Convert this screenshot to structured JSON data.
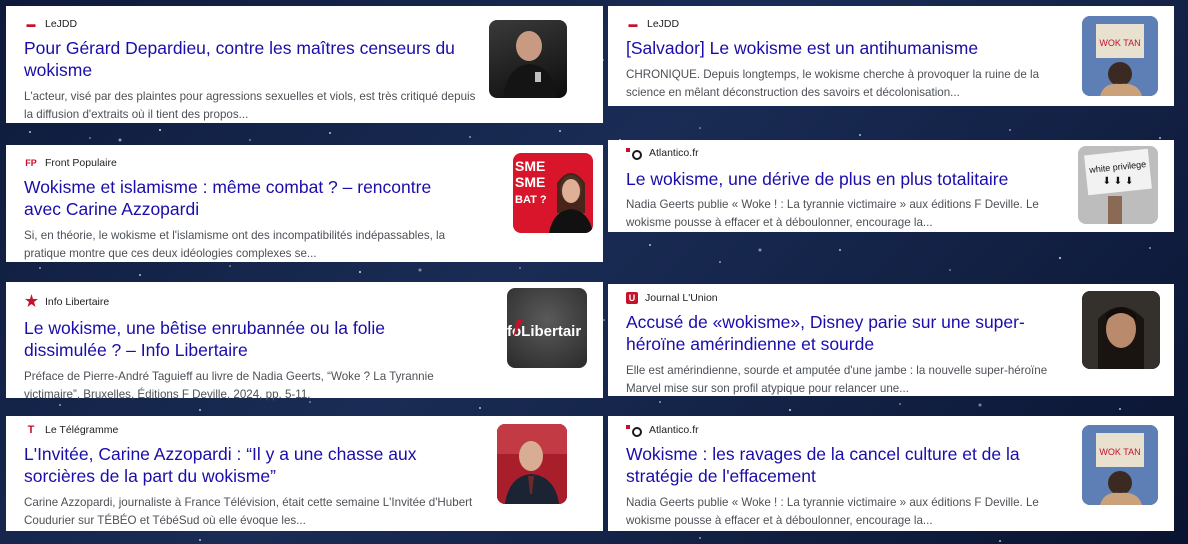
{
  "cards": [
    {
      "source": "LeJDD",
      "logo": "lejdd-logo-icon",
      "title": "Pour Gérard Depardieu, contre les maîtres censeurs du wokisme",
      "snippet": "L'acteur, visé par des plaintes pour agressions sexuelles et viols, est très critiqué depuis la diffusion d'extraits où il tient des propos...",
      "thumb": "depardieu-photo"
    },
    {
      "source": "LeJDD",
      "logo": "lejdd-logo-icon",
      "title": "[Salvador] Le wokisme est un antihumanisme",
      "snippet": "CHRONIQUE. Depuis longtemps, le wokisme cherche à provoquer la ruine de la science en mêlant déconstruction des savoirs et décolonisation...",
      "thumb": "woke-sign-photo",
      "thumb_text": "WOK TAN"
    },
    {
      "source": "Front Populaire",
      "logo": "front-populaire-logo-icon",
      "title": "Wokisme et islamisme : même combat ? – rencontre avec Carine Azzopardi",
      "snippet": "Si, en théorie, le wokisme et l'islamisme ont des incompatibilités indépassables, la pratique montre que ces deux idéologies complexes se...",
      "thumb": "azzopardi-interview-photo",
      "thumb_text": "SME\nSME\nBAT ?"
    },
    {
      "source": "Atlantico.fr",
      "logo": "atlantico-logo-icon",
      "title": "Le wokisme, une dérive de plus en plus totalitaire",
      "snippet": "Nadia Geerts publie « Woke ! : La tyrannie victimaire » aux éditions F Deville. Le wokisme pousse à effacer et à déboulonner, encourage la...",
      "thumb": "white-privilege-sign-photo",
      "thumb_text": "white privilege"
    },
    {
      "source": "Info Libertaire",
      "logo": "info-libertaire-logo-icon",
      "title": "Le wokisme, une bêtise enrubannée ou la folie dissimulée ? – Info Libertaire",
      "snippet": "Préface de Pierre-André Taguieff au livre de Nadia Geerts, “Woke ? La Tyrannie victimaire”, Bruxelles, Éditions F Deville, 2024, pp. 5-11.",
      "thumb": "info-libertaire-logo-image",
      "thumb_text": "foLibertair"
    },
    {
      "source": "Journal L'Union",
      "logo": "journal-union-logo-icon",
      "logo_letter": "U",
      "title": "Accusé de «wokisme», Disney parie sur une super-héroïne amérindienne et sourde",
      "snippet": "Elle est amérindienne, sourde et amputée d'une jambe : la nouvelle super-héroïne Marvel mise sur son profil atypique pour relancer une...",
      "thumb": "echo-heroine-photo"
    },
    {
      "source": "Le Télégramme",
      "logo": "le-telegramme-logo-icon",
      "logo_letter": "T",
      "title": "L'Invitée, Carine Azzopardi : “Il y a une chasse aux sorcières de la part du wokisme”",
      "snippet": "Carine Azzopardi, journaliste à France Télévision, était cette semaine L'Invitée d'Hubert Coudurier sur TÉBÉO et TébéSud où elle évoque les...",
      "thumb": "tebeo-interview-photo"
    },
    {
      "source": "Atlantico.fr",
      "logo": "atlantico-logo-icon",
      "title": "Wokisme : les ravages de la cancel culture et de la stratégie de l'effacement",
      "snippet": "Nadia Geerts publie « Woke ! : La tyrannie victimaire » aux éditions F Deville. Le wokisme pousse à effacer et à déboulonner, encourage la...",
      "thumb": "woke-sign-photo",
      "thumb_text": "WOK TAN"
    }
  ],
  "colors": {
    "title": "#1a0dab",
    "snippet": "#4d5156",
    "accent": "#c6112b",
    "background": "#0d1a3a"
  }
}
